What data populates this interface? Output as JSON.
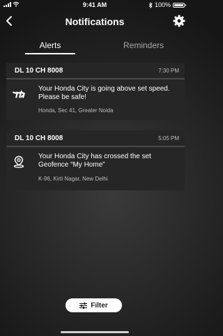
{
  "status_bar": {
    "time": "9:41 AM",
    "battery": "100%"
  },
  "header": {
    "title": "Notifications"
  },
  "tabs": [
    {
      "label": "Alerts",
      "active": true
    },
    {
      "label": "Reminders",
      "active": false
    }
  ],
  "notifications": [
    {
      "vehicle": "DL 10 CH 8008",
      "time": "7:30 PM",
      "icon": "speed-icon",
      "message": "Your Honda City is going above set speed. Please be safe!",
      "location": "Honda, Sec 41, Greater Noida"
    },
    {
      "vehicle": "DL 10 CH 8008",
      "time": "5:05 PM",
      "icon": "geofence-pin-icon",
      "message": "Your Honda City has crossed the set Geofence “My Home”",
      "location": "K-96, Kirti Nagar, New Delhi"
    }
  ],
  "filter": {
    "label": "Filter"
  },
  "colors": {
    "background": "#2a2a2a",
    "card": "#262626",
    "tab_underline": "#ffffff"
  }
}
